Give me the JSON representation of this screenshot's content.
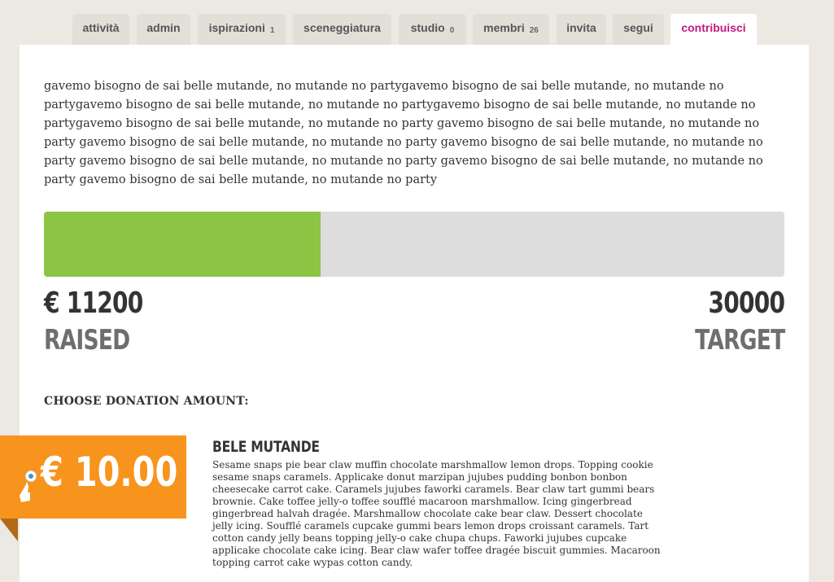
{
  "nav": {
    "tabs": [
      {
        "label": "attività",
        "count": null,
        "active": false
      },
      {
        "label": "admin",
        "count": null,
        "active": false
      },
      {
        "label": "ispirazioni",
        "count": "1",
        "active": false
      },
      {
        "label": "sceneggiatura",
        "count": null,
        "active": false
      },
      {
        "label": "studio",
        "count": "0",
        "active": false
      },
      {
        "label": "membri",
        "count": "26",
        "active": false
      },
      {
        "label": "invita",
        "count": null,
        "active": false
      },
      {
        "label": "segui",
        "count": null,
        "active": false
      },
      {
        "label": "contribuisci",
        "count": null,
        "active": true
      }
    ]
  },
  "intro_text": "gavemo bisogno de sai belle mutande, no mutande no partygavemo bisogno de sai belle mutande, no mutande no partygavemo bisogno de sai belle mutande, no mutande no partygavemo bisogno de sai belle mutande, no mutande no partygavemo bisogno de sai belle mutande, no mutande no party gavemo bisogno de sai belle mutande, no mutande no party gavemo bisogno de sai belle mutande, no mutande no party gavemo bisogno de sai belle mutande, no mutande no party gavemo bisogno de sai belle mutande, no mutande no party gavemo bisogno de sai belle mutande, no mutande no party gavemo bisogno de sai belle mutande, no mutande no party",
  "funding": {
    "raised_amount": "€ 11200",
    "raised_label": "RAISED",
    "target_amount": "30000",
    "target_label": "TARGET",
    "progress_fraction": 0.3733
  },
  "donation": {
    "heading": "CHOOSE DONATION AMOUNT:",
    "amount_label": "€ 10.00",
    "reward_title": "BELE MUTANDE",
    "reward_description": "Sesame snaps pie bear claw muffin chocolate marshmallow lemon drops. Topping cookie sesame snaps caramels. Applicake donut marzipan jujubes pudding bonbon bonbon cheesecake carrot cake. Caramels jujubes faworki caramels. Bear claw tart gummi bears brownie. Cake toffee jelly-o toffee soufflé macaroon marshmallow. Icing gingerbread gingerbread halvah dragée. Marshmallow chocolate cake bear claw. Dessert chocolate jelly icing. Soufflé caramels cupcake gummi bears lemon drops croissant caramels. Tart cotton candy jelly beans topping jelly-o cake chupa chups. Faworki jujubes cupcake applicake chocolate cake icing. Bear claw wafer toffee dragée biscuit gummies. Macaroon topping carrot cake wypas cotton candy."
  },
  "colors": {
    "progress_fill": "#8cc543",
    "progress_track": "#dddddd",
    "donate_button": "#f7941d",
    "active_tab_text": "#c2197e",
    "page_background": "#ece9e3"
  },
  "icons": {
    "donate_cursor": "hand-pointer-icon"
  }
}
